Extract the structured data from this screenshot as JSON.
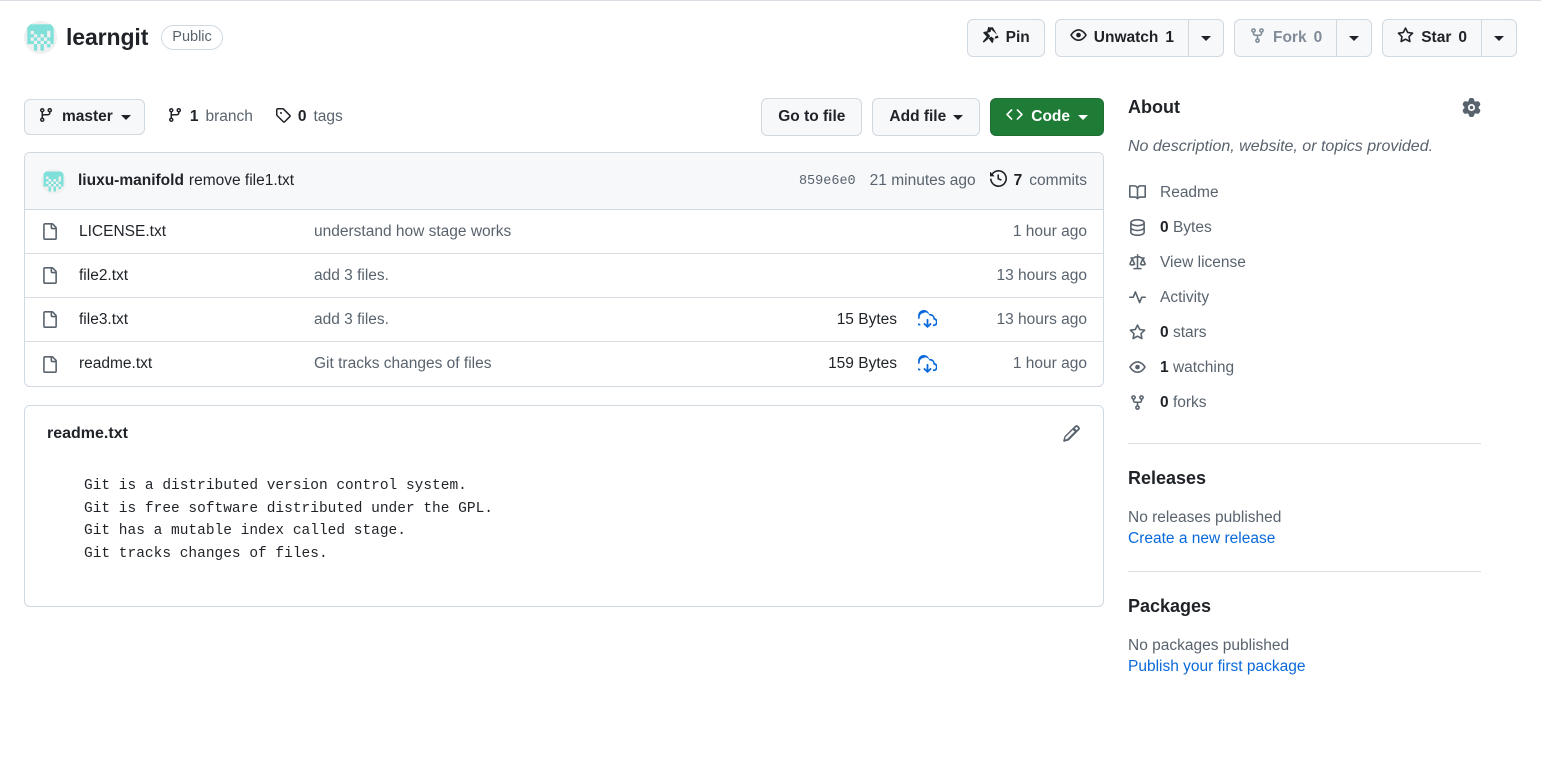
{
  "repo": {
    "name": "learngit",
    "visibility": "Public",
    "avatar_color": "#7ee0d8"
  },
  "header_actions": {
    "pin": {
      "label": "Pin",
      "icon": "pin-icon"
    },
    "watch": {
      "label": "Unwatch",
      "count": "1",
      "icon": "eye-icon"
    },
    "fork": {
      "label": "Fork",
      "count": "0",
      "icon": "repo-forked-icon"
    },
    "star": {
      "label": "Star",
      "count": "0",
      "icon": "star-icon"
    }
  },
  "file_toolbar": {
    "branch": "master",
    "branches_count": "1",
    "branches_label": "branch",
    "tags_count": "0",
    "tags_label": "tags",
    "go_to_file": "Go to file",
    "add_file": "Add file",
    "code": "Code"
  },
  "latest_commit": {
    "author": "liuxu-manifold",
    "message": "remove file1.txt",
    "sha": "859e6e0",
    "time": "21 minutes ago",
    "commits_count": "7",
    "commits_label": "commits"
  },
  "files": [
    {
      "name": "LICENSE.txt",
      "message": "understand how stage works",
      "size": "",
      "download": false,
      "time": "1 hour ago"
    },
    {
      "name": "file2.txt",
      "message": "add 3 files.",
      "size": "",
      "download": false,
      "time": "13 hours ago"
    },
    {
      "name": "file3.txt",
      "message": "add 3 files.",
      "size": "15 Bytes",
      "download": true,
      "time": "13 hours ago"
    },
    {
      "name": "readme.txt",
      "message": "Git tracks changes of files",
      "size": "159 Bytes",
      "download": true,
      "time": "1 hour ago"
    }
  ],
  "readme": {
    "title": "readme.txt",
    "edit_icon": "pencil-icon",
    "content": "Git is a distributed version control system.\nGit is free software distributed under the GPL.\nGit has a mutable index called stage.\nGit tracks changes of files."
  },
  "about": {
    "title": "About",
    "settings_icon": "gear-icon",
    "description": "No description, website, or topics provided.",
    "links": [
      {
        "icon": "book-icon",
        "label": "Readme",
        "strong": ""
      },
      {
        "icon": "database-icon",
        "label": "Bytes",
        "strong": "0"
      },
      {
        "icon": "law-icon",
        "label": "View license",
        "strong": ""
      },
      {
        "icon": "pulse-icon",
        "label": "Activity",
        "strong": ""
      },
      {
        "icon": "star-icon",
        "label": "stars",
        "strong": "0"
      },
      {
        "icon": "eye-icon",
        "label": "watching",
        "strong": "1"
      },
      {
        "icon": "fork-icon",
        "label": "forks",
        "strong": "0"
      }
    ]
  },
  "releases": {
    "title": "Releases",
    "empty": "No releases published",
    "action": "Create a new release"
  },
  "packages": {
    "title": "Packages",
    "empty": "No packages published",
    "action": "Publish your first package"
  },
  "colors": {
    "accent_link": "#0969da",
    "code_green": "#1f7c36",
    "muted_text": "#59636e"
  }
}
